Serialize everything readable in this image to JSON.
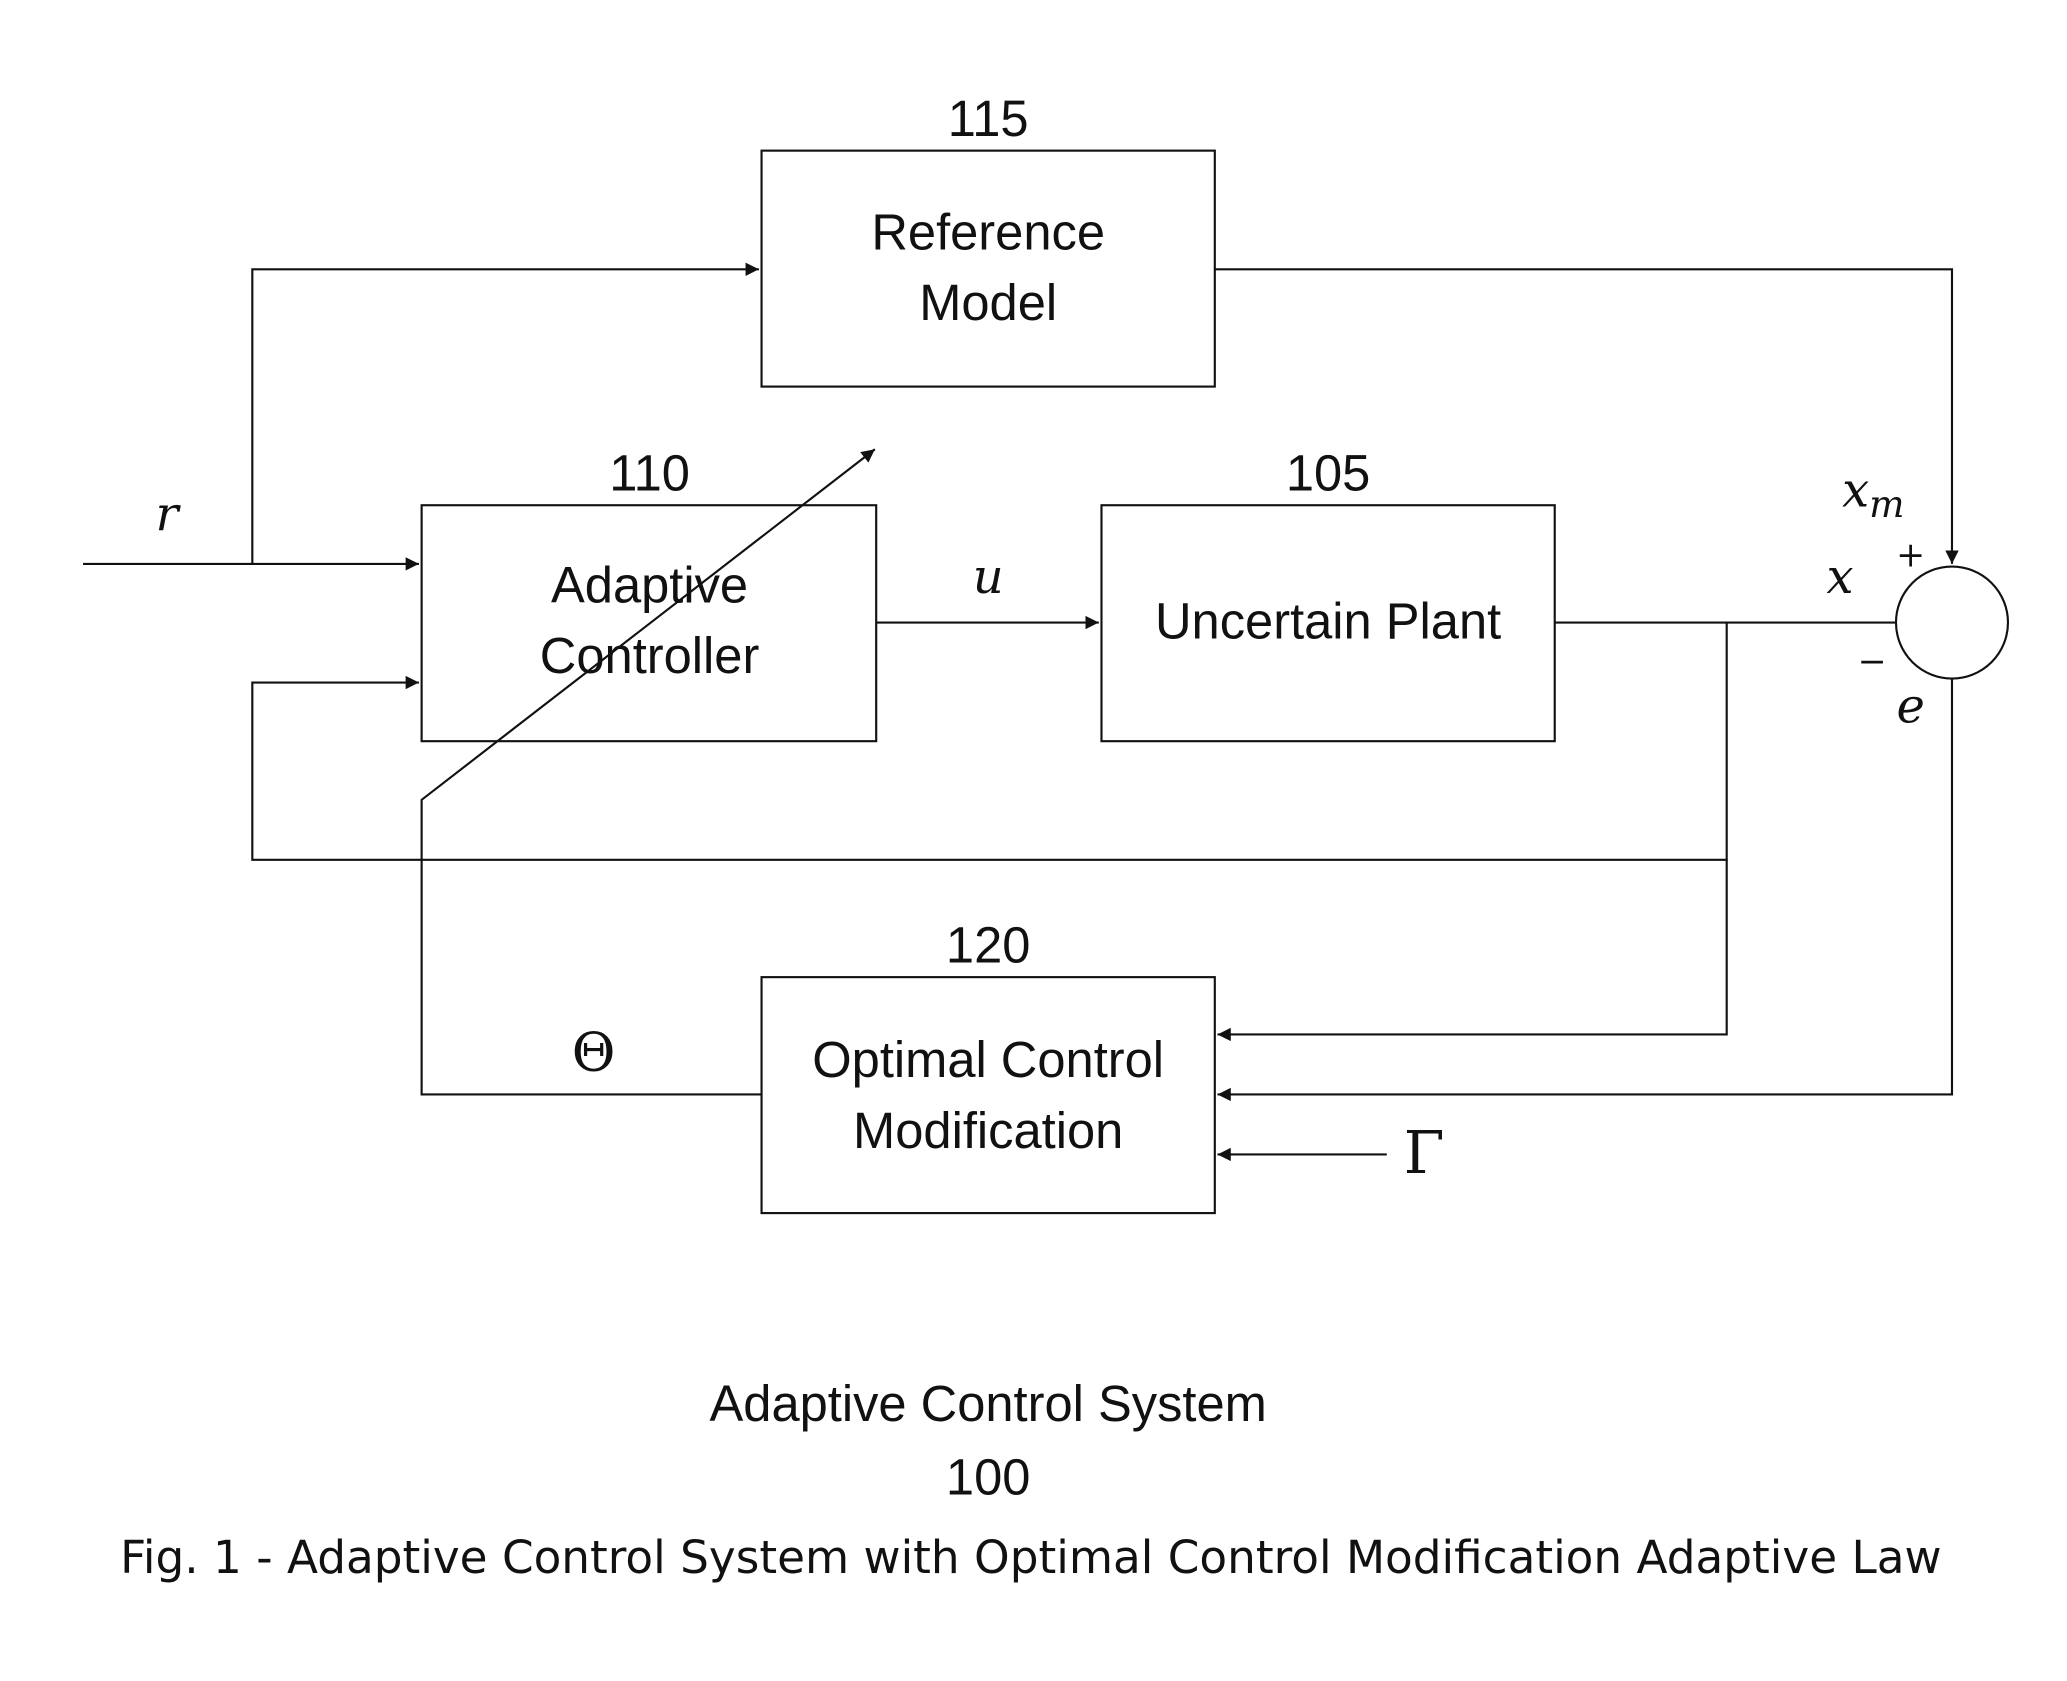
{
  "blocks": {
    "reference_model": {
      "number": "115",
      "line1": "Reference",
      "line2": "Model"
    },
    "adaptive_controller": {
      "number": "110",
      "line1": "Adaptive",
      "line2": "Controller"
    },
    "uncertain_plant": {
      "number": "105",
      "label": "Uncertain Plant"
    },
    "optimal_control_modification": {
      "number": "120",
      "line1": "Optimal Control",
      "line2": "Modification"
    }
  },
  "signals": {
    "r": "r",
    "u": "u",
    "x": "x",
    "xm": "x",
    "xm_sub": "m",
    "e": "e",
    "theta": "Θ",
    "gamma": "Γ",
    "plus": "+",
    "minus": "−"
  },
  "caption": {
    "title": "Adaptive Control System",
    "number": "100",
    "figure": "Fig. 1 - Adaptive Control System with Optimal Control Modification Adaptive Law"
  }
}
